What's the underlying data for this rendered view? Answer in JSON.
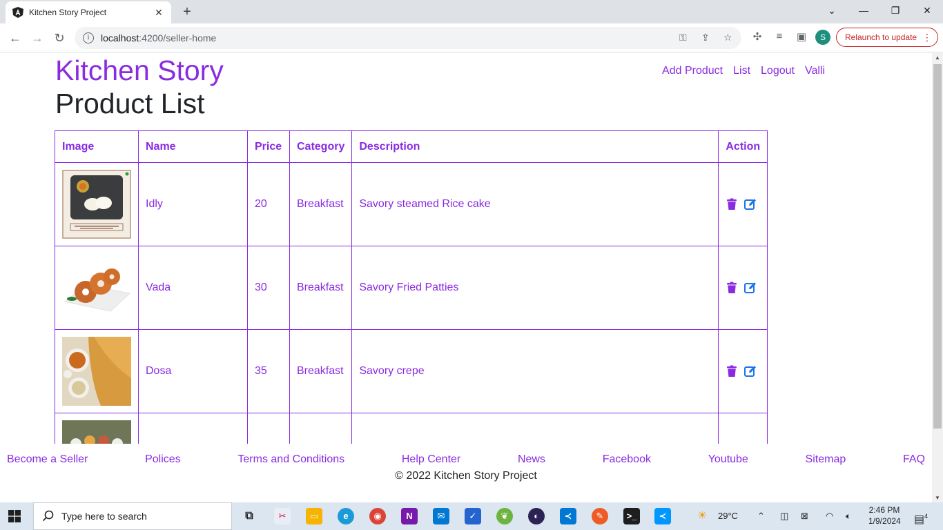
{
  "browser": {
    "tab_title": "Kitchen Story Project",
    "tab_close": "✕",
    "new_tab": "+",
    "url_host": "localhost",
    "url_path": ":4200/seller-home",
    "relaunch_label": "Relaunch to update",
    "profile_initial": "S",
    "icons": [
      "back-arrow-icon",
      "forward-arrow-icon",
      "reload-icon",
      "info-icon",
      "key-icon",
      "share-icon",
      "star-icon",
      "puzzle-icon",
      "reading-list-icon",
      "side-panel-icon"
    ]
  },
  "site": {
    "brand": "Kitchen Story",
    "nav": [
      "Add Product",
      "List",
      "Logout",
      "Valli"
    ],
    "page_title": "Product List"
  },
  "table": {
    "headers": [
      "Image",
      "Name",
      "Price",
      "Category",
      "Description",
      "Action"
    ],
    "rows": [
      {
        "name": "Idly",
        "price": "20",
        "category": "Breakfast",
        "description": "Savory steamed Rice cake"
      },
      {
        "name": "Vada",
        "price": "30",
        "category": "Breakfast",
        "description": "Savory Fried Patties"
      },
      {
        "name": "Dosa",
        "price": "35",
        "category": "Breakfast",
        "description": "Savory crepe"
      },
      {
        "name": "",
        "price": "",
        "category": "",
        "description": ""
      }
    ]
  },
  "footer": {
    "links": [
      "Become a Seller",
      "Polices",
      "Terms and Conditions",
      "Help Center",
      "News",
      "Facebook",
      "Youtube",
      "Sitemap",
      "FAQ"
    ],
    "copyright": "© 2022 Kitchen Story Project"
  },
  "taskbar": {
    "search_placeholder": "Type here to search",
    "weather": "29°C",
    "time": "2:46 PM",
    "date": "1/9/2024",
    "notification_count": "4"
  },
  "colors": {
    "accent": "#8a2be2",
    "edit": "#1a73e8"
  }
}
